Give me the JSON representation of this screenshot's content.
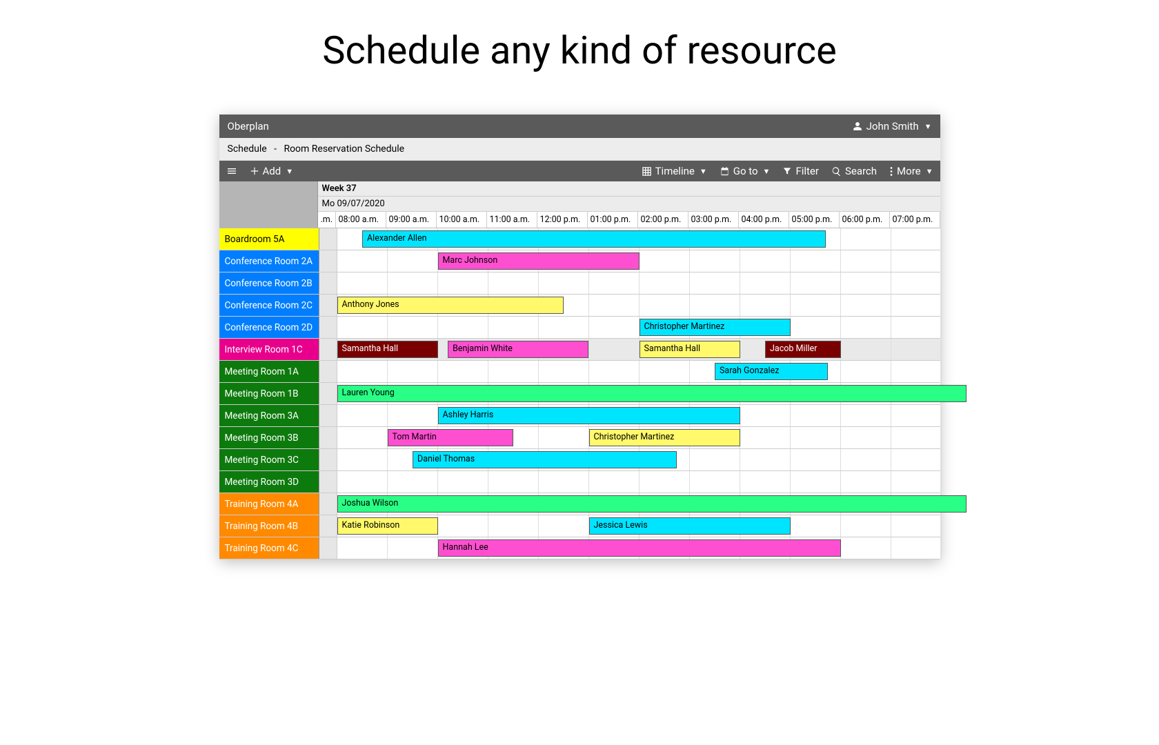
{
  "pageTitle": "Schedule any kind of resource",
  "app": {
    "name": "Oberplan",
    "user": "John Smith"
  },
  "breadcrumb": {
    "root": "Schedule",
    "sep": "-",
    "page": "Room Reservation Schedule"
  },
  "toolbar": {
    "add": "Add",
    "timeline": "Timeline",
    "goto": "Go to",
    "filter": "Filter",
    "search": "Search",
    "more": "More"
  },
  "timeHeader": {
    "week": "Week 37",
    "date": "Mo 09/07/2020",
    "firstFragment": ".m.",
    "hours": [
      "08:00 a.m.",
      "09:00 a.m.",
      "10:00 a.m.",
      "11:00 a.m.",
      "12:00 p.m.",
      "01:00 p.m.",
      "02:00 p.m.",
      "03:00 p.m.",
      "04:00 p.m.",
      "05:00 p.m.",
      "06:00 p.m.",
      "07:00 p.m."
    ]
  },
  "resources": [
    {
      "name": "Boardroom 5A",
      "bg": "#ffff00",
      "fg": "label-black",
      "events": [
        {
          "label": "Alexander Allen",
          "color": "#00e5ff",
          "txt": "#000",
          "start": 8.5,
          "end": 17.7
        }
      ]
    },
    {
      "name": "Conference Room 2A",
      "bg": "#007eff",
      "fg": "label-white",
      "events": [
        {
          "label": "Marc Johnson",
          "color": "#ff4fd1",
          "txt": "#000",
          "start": 10.0,
          "end": 14.0
        }
      ]
    },
    {
      "name": "Conference Room 2B",
      "bg": "#007eff",
      "fg": "label-white",
      "events": []
    },
    {
      "name": "Conference Room 2C",
      "bg": "#007eff",
      "fg": "label-white",
      "events": [
        {
          "label": "Anthony Jones",
          "color": "#fff96b",
          "txt": "#000",
          "start": 8.0,
          "end": 12.5
        }
      ]
    },
    {
      "name": "Conference Room 2D",
      "bg": "#007eff",
      "fg": "label-white",
      "events": [
        {
          "label": "Christopher Martinez",
          "color": "#00e5ff",
          "txt": "#000",
          "start": 14.0,
          "end": 17.0
        }
      ]
    },
    {
      "name": "Interview Room 1C",
      "bg": "#e8008c",
      "fg": "label-white",
      "odd": true,
      "events": [
        {
          "label": "Samantha Hall",
          "color": "#7a0000",
          "txt": "#fff",
          "start": 8.0,
          "end": 10.0
        },
        {
          "label": "Benjamin White",
          "color": "#ff4fd1",
          "txt": "#000",
          "start": 10.2,
          "end": 13.0
        },
        {
          "label": "Samantha Hall",
          "color": "#fff96b",
          "txt": "#000",
          "start": 14.0,
          "end": 16.0
        },
        {
          "label": "Jacob Miller",
          "color": "#7a0000",
          "txt": "#fff",
          "start": 16.5,
          "end": 18.0
        }
      ]
    },
    {
      "name": "Meeting Room 1A",
      "bg": "#0d7a0d",
      "fg": "label-white",
      "events": [
        {
          "label": "Sarah Gonzalez",
          "color": "#00e5ff",
          "txt": "#000",
          "start": 15.5,
          "end": 17.75
        }
      ]
    },
    {
      "name": "Meeting Room 1B",
      "bg": "#0d7a0d",
      "fg": "label-white",
      "events": [
        {
          "label": "Lauren Young",
          "color": "#29ff85",
          "txt": "#000",
          "start": 8.0,
          "end": 20.5
        }
      ]
    },
    {
      "name": "Meeting Room 3A",
      "bg": "#0d7a0d",
      "fg": "label-white",
      "events": [
        {
          "label": "Ashley Harris",
          "color": "#00e5ff",
          "txt": "#000",
          "start": 10.0,
          "end": 16.0
        }
      ]
    },
    {
      "name": "Meeting Room 3B",
      "bg": "#0d7a0d",
      "fg": "label-white",
      "events": [
        {
          "label": "Tom Martin",
          "color": "#ff4fd1",
          "txt": "#000",
          "start": 9.0,
          "end": 11.5
        },
        {
          "label": "Christopher Martinez",
          "color": "#fff96b",
          "txt": "#000",
          "start": 13.0,
          "end": 16.0
        }
      ]
    },
    {
      "name": "Meeting Room 3C",
      "bg": "#0d7a0d",
      "fg": "label-white",
      "events": [
        {
          "label": "Daniel Thomas",
          "color": "#00e5ff",
          "txt": "#000",
          "start": 9.5,
          "end": 14.75
        }
      ]
    },
    {
      "name": "Meeting Room 3D",
      "bg": "#0d7a0d",
      "fg": "label-white",
      "events": []
    },
    {
      "name": "Training Room 4A",
      "bg": "#ff8a00",
      "fg": "label-orange",
      "labelColor": "#fff",
      "events": [
        {
          "label": "Joshua Wilson",
          "color": "#29ff85",
          "txt": "#000",
          "start": 8.0,
          "end": 20.5
        }
      ]
    },
    {
      "name": "Training Room 4B",
      "bg": "#ff8a00",
      "fg": "label-orange",
      "labelColor": "#fff",
      "events": [
        {
          "label": "Katie Robinson",
          "color": "#fff96b",
          "txt": "#000",
          "start": 8.0,
          "end": 10.0
        },
        {
          "label": "Jessica Lewis",
          "color": "#00e5ff",
          "txt": "#000",
          "start": 13.0,
          "end": 17.0
        }
      ]
    },
    {
      "name": "Training Room 4C",
      "bg": "#ff8a00",
      "fg": "label-orange",
      "labelColor": "#fff",
      "events": [
        {
          "label": "Hannah Lee",
          "color": "#ff4fd1",
          "txt": "#000",
          "start": 10.0,
          "end": 18.0
        }
      ]
    }
  ],
  "layout": {
    "pxPerHour": 73,
    "trackOffset": 26,
    "startHour": 8
  }
}
